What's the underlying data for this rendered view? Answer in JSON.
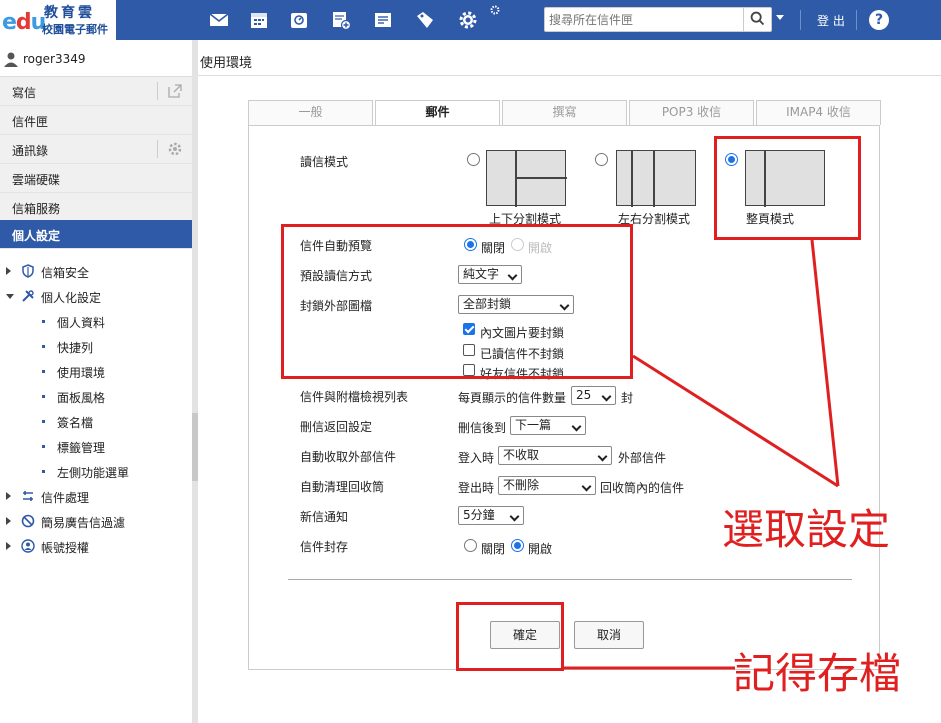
{
  "brand": {
    "logo_mark": "edu",
    "name_top": "教育雲",
    "name_bottom": "校園電子郵件"
  },
  "topbar": {
    "icons": [
      "mail-icon",
      "calendar-icon",
      "contacts-icon",
      "compose-icon",
      "notes-icon",
      "tag-icon",
      "settings-icon"
    ],
    "search_placeholder": "搜尋所在信件匣",
    "logout_label": "登 出",
    "help_label": "?"
  },
  "user": {
    "name": "roger3349"
  },
  "sidebar": {
    "items": [
      {
        "label": "寫信"
      },
      {
        "label": "信件匣"
      },
      {
        "label": "通訊錄"
      },
      {
        "label": "雲端硬碟"
      },
      {
        "label": "信箱服務"
      },
      {
        "label": "個人設定"
      }
    ],
    "tree": [
      {
        "label": "信箱安全",
        "icon": "shield-icon"
      },
      {
        "label": "個人化設定",
        "icon": "tools-icon"
      },
      {
        "label": "信件處理",
        "icon": "mail-process-icon"
      },
      {
        "label": "簡易廣告信過濾",
        "icon": "block-icon"
      },
      {
        "label": "帳號授權",
        "icon": "user-circle-icon"
      }
    ],
    "subitems": [
      "個人資料",
      "快捷列",
      "使用環境",
      "面板風格",
      "簽名檔",
      "標籤管理",
      "左側功能選單"
    ]
  },
  "main": {
    "title": "使用環境",
    "tabs": [
      "一般",
      "郵件",
      "撰寫",
      "POP3 收信",
      "IMAP4 收信"
    ],
    "active_tab": "郵件",
    "read_mode": {
      "label": "讀信模式",
      "options": [
        "上下分割模式",
        "左右分割模式",
        "整頁模式"
      ],
      "selected": "整頁模式"
    },
    "auto_preview": {
      "label": "信件自動預覽",
      "options": [
        "關閉",
        "開啟"
      ],
      "selected": "關閉"
    },
    "default_read": {
      "label": "預設讀信方式",
      "value": "純文字"
    },
    "block_external": {
      "label": "封鎖外部圖檔",
      "value": "全部封鎖",
      "checks": [
        {
          "label": "內文圖片要封鎖",
          "checked": true
        },
        {
          "label": "已讀信件不封鎖",
          "checked": false
        },
        {
          "label": "好友信件不封鎖",
          "checked": false
        }
      ]
    },
    "list_view": {
      "label": "信件與附檔檢視列表",
      "prefix": "每頁顯示的信件數量",
      "value": "25",
      "suffix": "封"
    },
    "after_delete": {
      "label": "刪信返回設定",
      "prefix": "刪信後到",
      "value": "下一篇"
    },
    "auto_fetch": {
      "label": "自動收取外部信件",
      "prefix": "登入時",
      "value": "不收取",
      "suffix": "外部信件"
    },
    "auto_clean": {
      "label": "自動清理回收筒",
      "prefix": "登出時",
      "value": "不刪除",
      "suffix": "回收筒內的信件"
    },
    "new_notify": {
      "label": "新信通知",
      "value": "5分鐘"
    },
    "archive": {
      "label": "信件封存",
      "options": [
        "關閉",
        "開啟"
      ],
      "selected": "開啟"
    },
    "ok_label": "確定",
    "cancel_label": "取消"
  },
  "annotations": {
    "select_note": "選取設定",
    "save_note": "記得存檔",
    "color": "#e02020"
  },
  "colors": {
    "topbar": "#2f5aa8",
    "accent": "#1a73e8"
  }
}
